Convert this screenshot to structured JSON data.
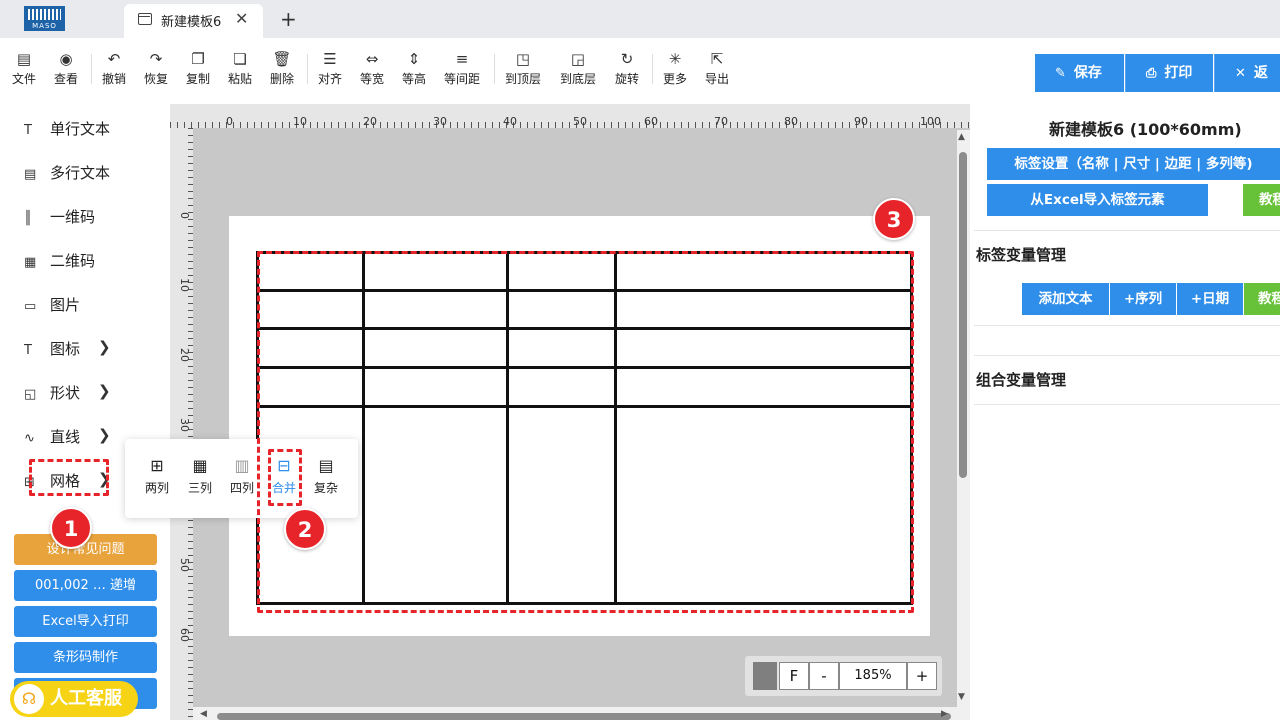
{
  "tabs": {
    "logo_text": "MASO",
    "active_tab": "新建模板6",
    "close_glyph": "✕",
    "new_tab_glyph": "+"
  },
  "toolbar": {
    "items": [
      {
        "label": "文件",
        "icon": "file-icon"
      },
      {
        "label": "查看",
        "icon": "eye-icon"
      },
      {
        "label": "撤销",
        "icon": "undo-icon"
      },
      {
        "label": "恢复",
        "icon": "redo-icon"
      },
      {
        "label": "复制",
        "icon": "copy-icon"
      },
      {
        "label": "粘贴",
        "icon": "paste-icon"
      },
      {
        "label": "删除",
        "icon": "trash-icon"
      },
      {
        "label": "对齐",
        "icon": "align-icon"
      },
      {
        "label": "等宽",
        "icon": "equal-width-icon"
      },
      {
        "label": "等高",
        "icon": "equal-height-icon"
      },
      {
        "label": "等间距",
        "icon": "equal-spacing-icon"
      },
      {
        "label": "到顶层",
        "icon": "bring-front-icon"
      },
      {
        "label": "到底层",
        "icon": "send-back-icon"
      },
      {
        "label": "旋转",
        "icon": "rotate-icon"
      },
      {
        "label": "更多",
        "icon": "more-icon"
      },
      {
        "label": "导出",
        "icon": "export-icon"
      }
    ],
    "save_label": "保存",
    "print_label": "打印",
    "back_label": "返回"
  },
  "sidebar": {
    "items": [
      {
        "label": "单行文本",
        "icon": "text-icon"
      },
      {
        "label": "多行文本",
        "icon": "multiline-text-icon"
      },
      {
        "label": "一维码",
        "icon": "barcode-icon"
      },
      {
        "label": "二维码",
        "icon": "qrcode-icon"
      },
      {
        "label": "图片",
        "icon": "image-icon"
      },
      {
        "label": "图标",
        "icon": "glyph-icon"
      },
      {
        "label": "形状",
        "icon": "shape-icon"
      },
      {
        "label": "直线",
        "icon": "line-icon"
      },
      {
        "label": "网格",
        "icon": "grid-icon"
      }
    ],
    "buttons": [
      {
        "label": "设计常见问题",
        "color": "#e8a33d"
      },
      {
        "label": "001,002 … 递增",
        "color": "#2f8eea"
      },
      {
        "label": "Excel导入打印",
        "color": "#2f8eea"
      },
      {
        "label": "条形码制作",
        "color": "#2f8eea"
      }
    ],
    "support_label": "人工客服"
  },
  "grid_popup": {
    "options": [
      {
        "label": "两列",
        "icon": "two-columns-icon"
      },
      {
        "label": "三列",
        "icon": "three-columns-icon"
      },
      {
        "label": "四列",
        "icon": "four-columns-icon"
      },
      {
        "label": "合并",
        "icon": "merge-icon"
      },
      {
        "label": "复杂",
        "icon": "complex-icon"
      }
    ],
    "active": "合并"
  },
  "rulers": {
    "top_ticks": [
      "0",
      "10",
      "20",
      "30",
      "40",
      "50",
      "60",
      "70",
      "80",
      "90",
      "100"
    ],
    "left_ticks": [
      "0",
      "10",
      "20",
      "30",
      "40",
      "50",
      "60"
    ]
  },
  "annotations": {
    "marker_1": "1",
    "marker_2": "2",
    "marker_3": "3"
  },
  "zoom": {
    "fit_label": "F",
    "minus_label": "-",
    "value": "185%",
    "plus_label": "+"
  },
  "right_panel": {
    "title": "新建模板6 (100*60mm)",
    "label_settings_btn": "标签设置（名称 | 尺寸 | 边距 | 多列等)",
    "import_excel_btn": "从Excel导入标签元素",
    "tutorial_btn": "教程",
    "variable_section": "标签变量管理",
    "add_text_btn": "添加文本",
    "add_sequence_btn": "+序列",
    "add_date_btn": "+日期",
    "tutorial_btn_2": "教程",
    "combo_section": "组合变量管理",
    "accent_green": "#67c23a",
    "accent_blue": "#2f8eea"
  }
}
